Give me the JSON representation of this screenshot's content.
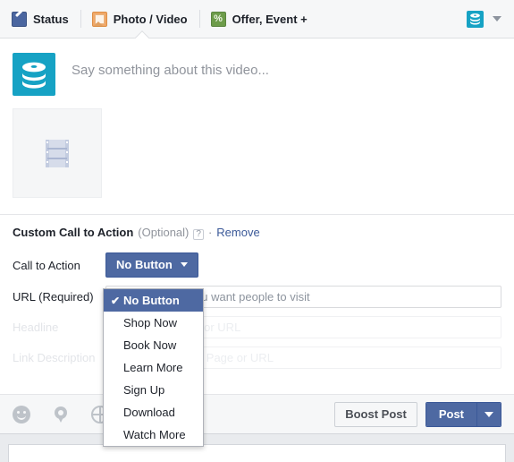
{
  "tabbar": {
    "tabs": [
      {
        "label": "Status",
        "icon": "pencil-icon",
        "active": false
      },
      {
        "label": "Photo / Video",
        "icon": "photo-icon",
        "active": true
      },
      {
        "label": "Offer, Event +",
        "icon": "offer-icon",
        "active": false
      }
    ],
    "avatar_icon": "page-avatar-icon",
    "menu_caret_icon": "chevron-down-icon"
  },
  "composer": {
    "avatar_icon": "page-avatar-icon",
    "status_placeholder": "Say something about this video...",
    "attachment_icon": "film-strip-icon"
  },
  "cta": {
    "title": "Custom Call to Action",
    "optional": "(Optional)",
    "help_badge": "?",
    "separator": "·",
    "remove_label": "Remove",
    "rows": [
      {
        "label": "Call to Action",
        "type": "dropdown",
        "value": "No Button",
        "disabled": false
      },
      {
        "label": "URL (Required)",
        "type": "input",
        "value": "",
        "placeholder": "Enter the URL you want people to visit",
        "disabled": false
      },
      {
        "label": "Headline",
        "type": "input",
        "value": "",
        "placeholder": "Title for the Page or URL",
        "disabled": true
      },
      {
        "label": "Link Description",
        "type": "input",
        "value": "",
        "placeholder": "Description of the Page or URL",
        "disabled": true
      }
    ]
  },
  "dropdown_menu": {
    "open": true,
    "selected": "No Button",
    "check_glyph": "✔",
    "items": [
      "No Button",
      "Shop Now",
      "Book Now",
      "Learn More",
      "Sign Up",
      "Download",
      "Watch More"
    ]
  },
  "footer": {
    "icons": [
      {
        "name": "smiley-icon"
      },
      {
        "name": "location-pin-icon"
      },
      {
        "name": "audience-globe-icon"
      }
    ],
    "boost_label": "Boost Post",
    "post_label": "Post",
    "post_caret_icon": "chevron-down-icon"
  },
  "colors": {
    "facebook_blue": "#4e69a2",
    "blue_border": "#3b5998",
    "link_blue": "#3b5998",
    "avatar_teal": "#16a2c4",
    "chrome_gray": "#f6f7f8",
    "page_bg": "#e9ebee",
    "muted_text": "#90949c",
    "disabled_text": "#e3e5e9"
  }
}
